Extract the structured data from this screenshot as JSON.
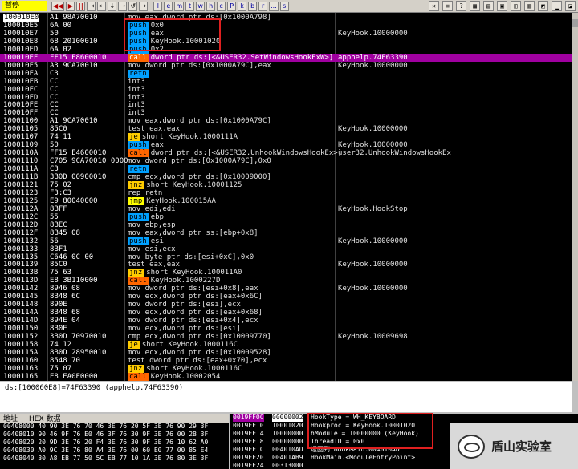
{
  "toolbar": {
    "status": "暂停",
    "buttons": [
      "◀◀",
      "▶",
      "||",
      "⇥",
      "⇤",
      "↓",
      "→",
      "↺",
      "⇢"
    ],
    "letters": [
      "l",
      "e",
      "m",
      "t",
      "w",
      "h",
      "c",
      "P",
      "k",
      "b",
      "r",
      "...",
      "s"
    ]
  },
  "cpu_rows": [
    {
      "addr": "100010E0",
      "hex": "A1 98A70010",
      "dis": "mov eax,dword ptr ds:[0x1000A798]",
      "com": ""
    },
    {
      "addr": "100010E5",
      "hex": "6A 00",
      "dis": "0x0",
      "kw": "push",
      "kwc": "push",
      "com": ""
    },
    {
      "addr": "100010E7",
      "hex": "50",
      "dis": "eax",
      "kw": "push",
      "kwc": "push",
      "com": "KeyHook.10000000"
    },
    {
      "addr": "100010E8",
      "hex": "68 20100010",
      "dis": "KeyHook.10001020",
      "kw": "push",
      "kwc": "push",
      "com": ""
    },
    {
      "addr": "100010ED",
      "hex": "6A 02",
      "dis": "0x2",
      "kw": "push",
      "kwc": "push",
      "com": ""
    },
    {
      "addr": "100010EF",
      "hex": "FF15 E8600010",
      "dis": "dword ptr ds:[<&USER32.SetWindowsHookExW>]",
      "kw": "call",
      "kwc": "call",
      "com": "apphelp.74F63390",
      "hl": true
    },
    {
      "addr": "100010F5",
      "hex": "A3 9CA70010",
      "dis": "mov dword ptr ds:[0x1000A79C],eax",
      "com": "KeyHook.10000000"
    },
    {
      "addr": "100010FA",
      "hex": "C3",
      "dis": "",
      "kw": "retn",
      "kwc": "ret",
      "com": ""
    },
    {
      "addr": "100010FB",
      "hex": "CC",
      "dis": "int3",
      "com": ""
    },
    {
      "addr": "100010FC",
      "hex": "CC",
      "dis": "int3",
      "com": ""
    },
    {
      "addr": "100010FD",
      "hex": "CC",
      "dis": "int3",
      "com": ""
    },
    {
      "addr": "100010FE",
      "hex": "CC",
      "dis": "int3",
      "com": ""
    },
    {
      "addr": "100010FF",
      "hex": "CC",
      "dis": "int3",
      "com": ""
    },
    {
      "addr": "10001100",
      "hex": "A1 9CA70010",
      "dis": "mov eax,dword ptr ds:[0x1000A79C]",
      "com": ""
    },
    {
      "addr": "10001105",
      "hex": "85C0",
      "dis": "test eax,eax",
      "com": "KeyHook.10000000"
    },
    {
      "addr": "10001107",
      "hex": "74 11",
      "dis": "short KeyHook.1000111A",
      "kw": "je",
      "kwc": "jcc",
      "com": ""
    },
    {
      "addr": "10001109",
      "hex": "50",
      "dis": "eax",
      "kw": "push",
      "kwc": "push",
      "com": "KeyHook.10000000"
    },
    {
      "addr": "1000110A",
      "hex": "FF15 E4600010",
      "dis": "dword ptr ds:[<&USER32.UnhookWindowsHookEx>]",
      "kw": "call",
      "kwc": "call",
      "com": "user32.UnhookWindowsHookEx"
    },
    {
      "addr": "10001110",
      "hex": "C705 9CA70010 0000",
      "dis": "mov dword ptr ds:[0x1000A79C],0x0",
      "com": ""
    },
    {
      "addr": "1000111A",
      "hex": "C3",
      "dis": "",
      "kw": "retn",
      "kwc": "ret",
      "com": ""
    },
    {
      "addr": "1000111B",
      "hex": "3B0D 00900010",
      "dis": "cmp ecx,dword ptr ds:[0x10009000]",
      "com": ""
    },
    {
      "addr": "10001121",
      "hex": "75 02",
      "dis": "short KeyHook.10001125",
      "kw": "jnz",
      "kwc": "jcc",
      "com": ""
    },
    {
      "addr": "10001123",
      "hex": "F3:C3",
      "dis": "rep retn",
      "com": ""
    },
    {
      "addr": "10001125",
      "hex": "E9 80040000",
      "dis": "KeyHook.100015AA",
      "kw": "jmp",
      "kwc": "jmp",
      "com": ""
    },
    {
      "addr": "1000112A",
      "hex": "8BFF",
      "dis": "mov edi,edi",
      "com": "KeyHook.HookStop"
    },
    {
      "addr": "1000112C",
      "hex": "55",
      "dis": "ebp",
      "kw": "push",
      "kwc": "push",
      "com": ""
    },
    {
      "addr": "1000112D",
      "hex": "8BEC",
      "dis": "mov ebp,esp",
      "com": ""
    },
    {
      "addr": "1000112F",
      "hex": "8B45 08",
      "dis": "mov eax,dword ptr ss:[ebp+0x8]",
      "com": ""
    },
    {
      "addr": "10001132",
      "hex": "56",
      "dis": "esi",
      "kw": "push",
      "kwc": "push",
      "com": "KeyHook.10000000"
    },
    {
      "addr": "10001133",
      "hex": "8BF1",
      "dis": "mov esi,ecx",
      "com": ""
    },
    {
      "addr": "10001135",
      "hex": "C646 0C 00",
      "dis": "mov byte ptr ds:[esi+0xC],0x0",
      "com": ""
    },
    {
      "addr": "10001139",
      "hex": "85C0",
      "dis": "test eax,eax",
      "com": "KeyHook.10000000"
    },
    {
      "addr": "1000113B",
      "hex": "75 63",
      "dis": "short KeyHook.100011A0",
      "kw": "jnz",
      "kwc": "jcc",
      "com": ""
    },
    {
      "addr": "1000113D",
      "hex": "E8 3B110000",
      "dis": "KeyHook.1000227D",
      "kw": "call",
      "kwc": "call",
      "com": ""
    },
    {
      "addr": "10001142",
      "hex": "8946 08",
      "dis": "mov dword ptr ds:[esi+0x8],eax",
      "com": "KeyHook.10000000"
    },
    {
      "addr": "10001145",
      "hex": "8B48 6C",
      "dis": "mov ecx,dword ptr ds:[eax+0x6C]",
      "com": ""
    },
    {
      "addr": "10001148",
      "hex": "890E",
      "dis": "mov dword ptr ds:[esi],ecx",
      "com": ""
    },
    {
      "addr": "1000114A",
      "hex": "8B48 68",
      "dis": "mov ecx,dword ptr ds:[eax+0x68]",
      "com": ""
    },
    {
      "addr": "1000114D",
      "hex": "894E 04",
      "dis": "mov dword ptr ds:[esi+0x4],ecx",
      "com": ""
    },
    {
      "addr": "10001150",
      "hex": "8B0E",
      "dis": "mov ecx,dword ptr ds:[esi]",
      "com": ""
    },
    {
      "addr": "10001152",
      "hex": "3B0D 70970010",
      "dis": "cmp ecx,dword ptr ds:[0x10009770]",
      "com": "KeyHook.10009698"
    },
    {
      "addr": "10001158",
      "hex": "74 12",
      "dis": "short KeyHook.1000116C",
      "kw": "je",
      "kwc": "jcc",
      "com": ""
    },
    {
      "addr": "1000115A",
      "hex": "8B0D 28950010",
      "dis": "mov ecx,dword ptr ds:[0x10009528]",
      "com": ""
    },
    {
      "addr": "10001160",
      "hex": "8548 70",
      "dis": "test dword ptr ds:[eax+0x70],ecx",
      "com": ""
    },
    {
      "addr": "10001163",
      "hex": "75 07",
      "dis": "short KeyHook.1000116C",
      "kw": "jnz",
      "kwc": "jcc",
      "com": ""
    },
    {
      "addr": "10001165",
      "hex": "E8 EA0E0000",
      "dis": "KeyHook.10002054",
      "kw": "call",
      "kwc": "call",
      "com": ""
    }
  ],
  "status_line": "ds:[100060E8]=74F63390 (apphelp.74F63390)",
  "hex_header": {
    "addr": "地址",
    "hex": "HEX 数据"
  },
  "hex_rows": [
    "00408000 40 90 3E 76 70 46 3E 76 20 5F 3E 76 90 29 3F",
    "00408010 90 46 9F 76 E0 46 3F 76 30 9F 3E 76 00 2B 3F",
    "00408020 20 9D 3E 76 20 F4 3E 76 30 9F 3E 76 10 62 A0",
    "00408030 A0 9C 3E 76 80 A4 3E 76 00 60 E0 77 00 85 E4",
    "00408040 30 A8 EB 77 50 5C EB 77 10 1A 3E 76 80 3E 3F"
  ],
  "stack_rows": [
    {
      "addr": "0019FF0C",
      "val": "00000002",
      "com": "HookType = WH_KEYBOARD",
      "top": true
    },
    {
      "addr": "0019FF10",
      "val": "10001020",
      "com": "Hookproc = KeyHook.10001020"
    },
    {
      "addr": "0019FF14",
      "val": "10000000",
      "com": "hModule = 10000000 (KeyHook)"
    },
    {
      "addr": "0019FF18",
      "val": "00000000",
      "com": "ThreadID = 0x0"
    },
    {
      "addr": "0019FF1C",
      "val": "004010AD",
      "com": "返回到 HookMain.004010AD"
    },
    {
      "addr": "0019FF20",
      "val": "00401AB9",
      "com": "HookMain.<ModuleEntryPoint>"
    },
    {
      "addr": "0019FF24",
      "val": "00313000",
      "com": ""
    }
  ],
  "watermark": {
    "text": "盾山实验室"
  }
}
